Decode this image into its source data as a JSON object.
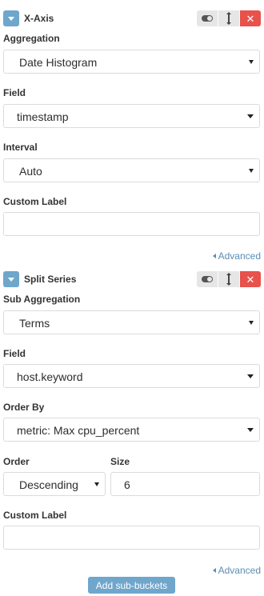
{
  "x_axis": {
    "title": "X-Axis",
    "aggregation_label": "Aggregation",
    "aggregation_value": "Date Histogram",
    "field_label": "Field",
    "field_value": "timestamp",
    "interval_label": "Interval",
    "interval_value": "Auto",
    "custom_label_label": "Custom Label",
    "custom_label_value": "",
    "advanced_link": "Advanced"
  },
  "split_series": {
    "title": "Split Series",
    "sub_aggregation_label": "Sub Aggregation",
    "sub_aggregation_value": "Terms",
    "field_label": "Field",
    "field_value": "host.keyword",
    "order_by_label": "Order By",
    "order_by_value": "metric: Max cpu_percent",
    "order_label": "Order",
    "order_value": "Descending",
    "size_label": "Size",
    "size_value": "6",
    "custom_label_label": "Custom Label",
    "custom_label_value": "",
    "advanced_link": "Advanced"
  },
  "add_sub_buckets_label": "Add sub-buckets",
  "colors": {
    "accent": "#6fa6cc",
    "remove": "#e7524b",
    "link": "#5b8db3"
  }
}
